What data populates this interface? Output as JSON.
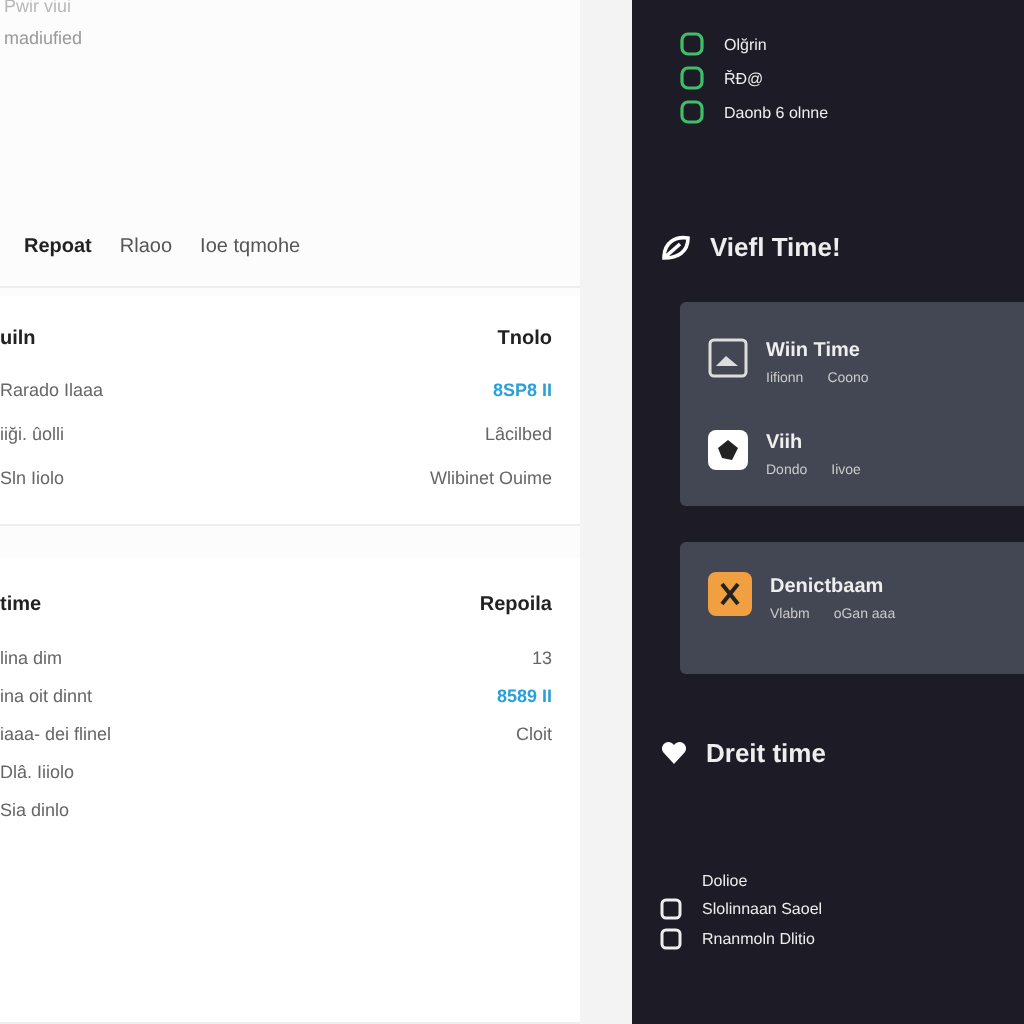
{
  "header": {
    "title": "Pwir viui",
    "subtitle": "madiufied"
  },
  "tabs": [
    {
      "label": "Repoat",
      "selected": true
    },
    {
      "label": "Rlaoo",
      "selected": false
    },
    {
      "label": "Ioe tqmohe",
      "selected": false
    }
  ],
  "cards": [
    {
      "title": "uiln",
      "heading": "Tnolo",
      "rows": [
        {
          "label": "Rarado Ilaaa",
          "value": "8SP8 II",
          "highlight": true
        },
        {
          "label": "iiği. ûolli",
          "value": "Lâcilbed",
          "highlight": false
        },
        {
          "label": "Sln Iiolo",
          "value": "Wlibinet Ouime",
          "highlight": false
        }
      ]
    },
    {
      "title": "time",
      "heading": "Repoila",
      "rows": [
        {
          "label": "lina dim",
          "value": "13",
          "highlight": false
        },
        {
          "label": "ina oit dinnt",
          "value": "8589 II",
          "highlight": true
        },
        {
          "label": "iaaa- dei flinel",
          "value": "Cloit",
          "highlight": false
        },
        {
          "label": "Dlâ. Iiiolo"
        },
        {
          "label": "Sia dinlo"
        }
      ]
    }
  ],
  "side": {
    "links": [
      "Olğrin",
      "ŘĐ@",
      "Daonb 6 olnne"
    ],
    "section1": {
      "title": "Viefl Time!",
      "items": [
        {
          "title": "Wiin Time",
          "meta": [
            "Iifionn",
            "Coono"
          ]
        },
        {
          "title": "Viih",
          "meta": [
            "Dondo",
            "Iivoe"
          ]
        }
      ]
    },
    "section2": {
      "items": [
        {
          "title": "Denictbaam",
          "meta": [
            "Vlabm",
            "oGan aaa"
          ]
        }
      ]
    },
    "section3": {
      "title": "Dreit time",
      "items": [
        "Dolioe",
        "Slolinnaan Saoel",
        "Rnanmoln Dlitio"
      ]
    }
  }
}
